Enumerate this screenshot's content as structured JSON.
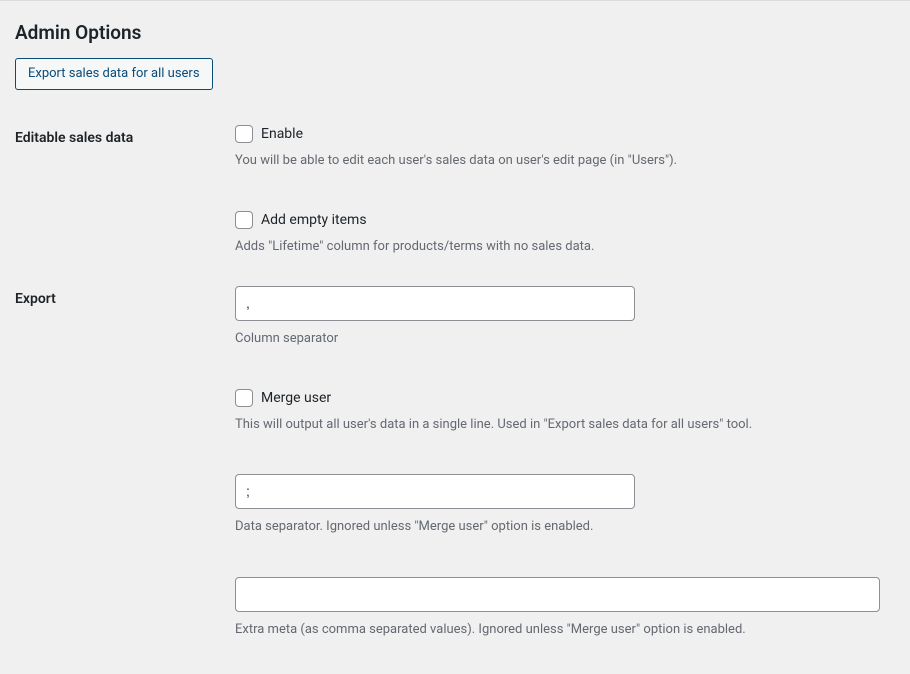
{
  "heading": "Admin Options",
  "exportButton": "Export sales data for all users",
  "rows": {
    "editableSalesData": {
      "label": "Editable sales data",
      "enable": {
        "label": "Enable",
        "description": "You will be able to edit each user's sales data on user's edit page (in \"Users\")."
      },
      "addEmpty": {
        "label": "Add empty items",
        "description": "Adds \"Lifetime\" column for products/terms with no sales data."
      }
    },
    "export": {
      "label": "Export",
      "columnSeparator": {
        "value": ",",
        "description": "Column separator"
      },
      "mergeUser": {
        "label": "Merge user",
        "description": "This will output all user's data in a single line. Used in \"Export sales data for all users\" tool."
      },
      "dataSeparator": {
        "value": ";",
        "description": "Data separator. Ignored unless \"Merge user\" option is enabled."
      },
      "extraMeta": {
        "value": "",
        "description": "Extra meta (as comma separated values). Ignored unless \"Merge user\" option is enabled."
      }
    }
  }
}
